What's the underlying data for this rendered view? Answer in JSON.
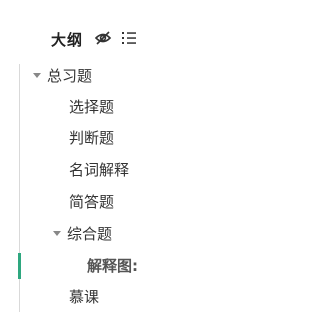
{
  "outline": {
    "title": "大纲",
    "hide_icon": "eye-off-icon",
    "list_icon": "list-icon",
    "accent_color": "#2ea77f",
    "nodes": [
      {
        "label": "总习题",
        "level": 1,
        "expanded": true
      },
      {
        "label": "选择题",
        "level": 2
      },
      {
        "label": "判断题",
        "level": 2
      },
      {
        "label": "名词解释",
        "level": 2
      },
      {
        "label": "简答题",
        "level": 2
      },
      {
        "label": "综合题",
        "level": 2,
        "expanded": true
      },
      {
        "label": "解释图:",
        "level": 3,
        "active": true
      },
      {
        "label": "慕课",
        "level": 2
      }
    ]
  }
}
